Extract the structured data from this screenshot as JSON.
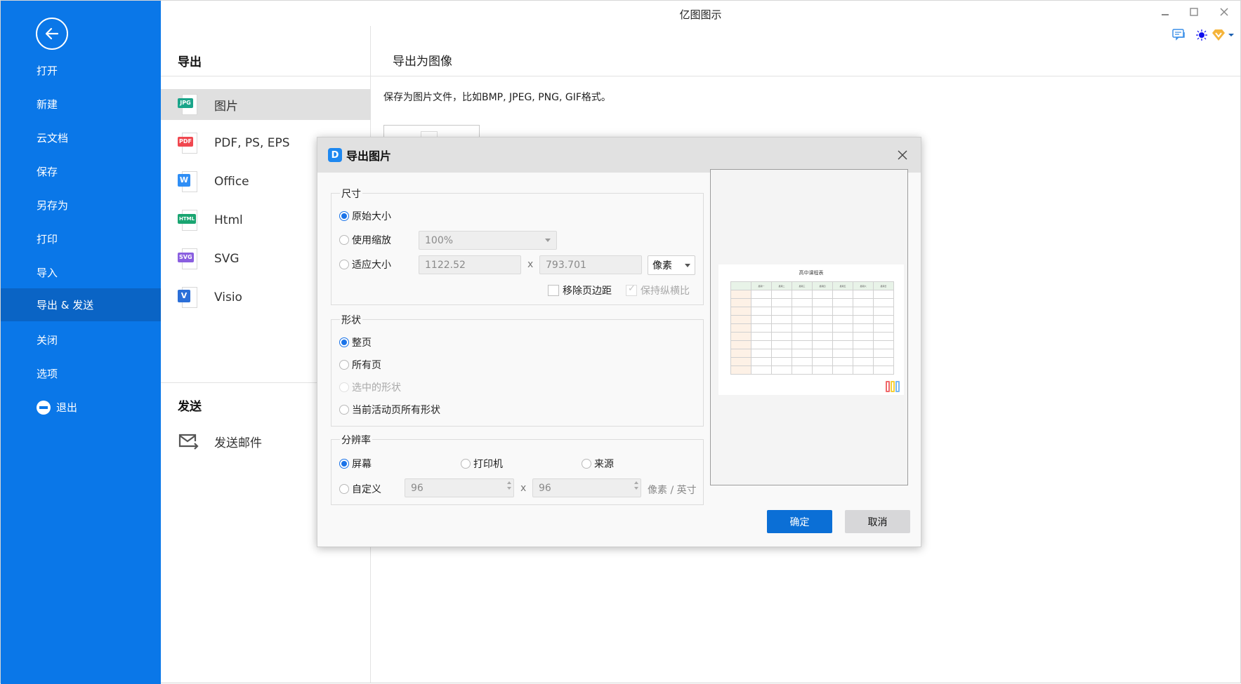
{
  "window": {
    "title": "亿图图示",
    "controls": {
      "minimize": "minimize",
      "maximize": "maximize",
      "close": "close"
    },
    "toolbar_icons": [
      "comment-icon",
      "theme-sun-icon",
      "vip-badge-icon",
      "dropdown-caret-icon"
    ]
  },
  "sidebar": {
    "back_icon": "arrow-left-icon",
    "items": [
      {
        "label": "打开",
        "active": false
      },
      {
        "label": "新建",
        "active": false
      },
      {
        "label": "云文档",
        "active": false
      },
      {
        "label": "保存",
        "active": false
      },
      {
        "label": "另存为",
        "active": false
      },
      {
        "label": "打印",
        "active": false
      },
      {
        "label": "导入",
        "active": false
      },
      {
        "label": "导出 & 发送",
        "active": true
      },
      {
        "label": "关闭",
        "active": false
      },
      {
        "label": "选项",
        "active": false
      },
      {
        "label": "退出",
        "active": false,
        "icon": "exit-minus-circle-icon"
      }
    ]
  },
  "export_panel": {
    "title": "导出",
    "items": [
      {
        "label": "图片",
        "tag": "JPG",
        "color": "#1aa58a",
        "active": true
      },
      {
        "label": "PDF, PS, EPS",
        "tag": "PDF",
        "color": "#f0474f",
        "active": false
      },
      {
        "label": "Office",
        "tag": "W",
        "color": "#2f8ef5",
        "active": false
      },
      {
        "label": "Html",
        "tag": "HTML",
        "color": "#1aa571",
        "active": false
      },
      {
        "label": "SVG",
        "tag": "SVG",
        "color": "#8a5fe0",
        "active": false
      },
      {
        "label": "Visio",
        "tag": "V",
        "color": "#2b6fd8",
        "active": false
      }
    ],
    "send_title": "发送",
    "send_items": [
      {
        "label": "发送邮件",
        "icon": "mail-send-icon"
      }
    ]
  },
  "detail": {
    "title": "导出为图像",
    "description": "保存为图片文件，比如BMP, JPEG, PNG, GIF格式。"
  },
  "dialog": {
    "title": "导出图片",
    "size_group": {
      "legend": "尺寸",
      "options": [
        {
          "label": "原始大小",
          "selected": true
        },
        {
          "label": "使用缩放",
          "selected": false
        },
        {
          "label": "适应大小",
          "selected": false
        }
      ],
      "zoom_value": "100%",
      "width_value": "1122.52",
      "times": "x",
      "height_value": "793.701",
      "unit": "像素",
      "remove_margin_label": "移除页边距",
      "remove_margin_checked": false,
      "keep_ratio_label": "保持纵横比",
      "keep_ratio_checked": true
    },
    "shape_group": {
      "legend": "形状",
      "options": [
        {
          "label": "整页",
          "selected": true,
          "disabled": false
        },
        {
          "label": "所有页",
          "selected": false,
          "disabled": false
        },
        {
          "label": "选中的形状",
          "selected": false,
          "disabled": true
        },
        {
          "label": "当前活动页所有形状",
          "selected": false,
          "disabled": false
        }
      ]
    },
    "resolution_group": {
      "legend": "分辨率",
      "options": [
        {
          "label": "屏幕",
          "selected": true
        },
        {
          "label": "打印机",
          "selected": false
        },
        {
          "label": "来源",
          "selected": false
        },
        {
          "label": "自定义",
          "selected": false
        }
      ],
      "dpi_x": "96",
      "times": "x",
      "dpi_y": "96",
      "unit": "像素 / 英寸"
    },
    "preview": {
      "title": "高中课程表",
      "header": [
        "",
        "星期一",
        "星期二",
        "星期三",
        "星期四",
        "星期五",
        "星期六",
        "星期日"
      ],
      "rows": 10
    },
    "ok_label": "确定",
    "cancel_label": "取消"
  }
}
